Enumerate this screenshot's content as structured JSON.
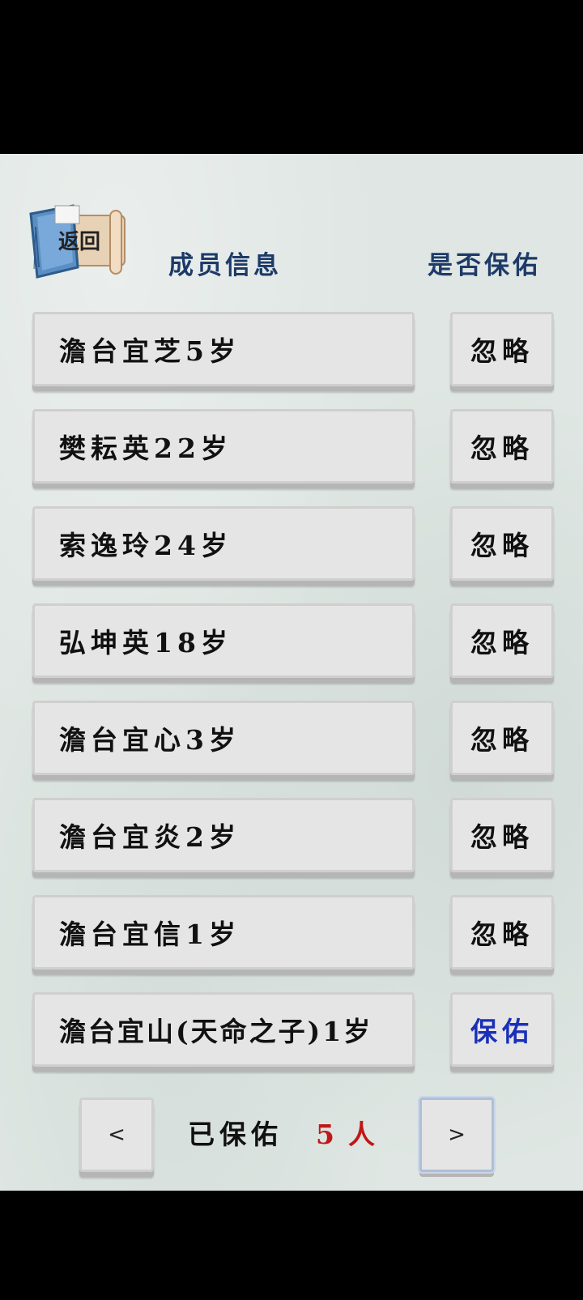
{
  "header": {
    "back_label": "返回",
    "col_member": "成员信息",
    "col_bless": "是否保佑"
  },
  "members": [
    {
      "name": "澹台宜芝5岁",
      "action": "忽略"
    },
    {
      "name": "樊耘英22岁",
      "action": "忽略"
    },
    {
      "name": "索逸玲24岁",
      "action": "忽略"
    },
    {
      "name": "弘坤英18岁",
      "action": "忽略"
    },
    {
      "name": "澹台宜心3岁",
      "action": "忽略"
    },
    {
      "name": "澹台宜炎2岁",
      "action": "忽略"
    },
    {
      "name": "澹台宜信1岁",
      "action": "忽略"
    },
    {
      "name": "澹台宜山(天命之子)1岁",
      "action": "保佑"
    }
  ],
  "footer": {
    "prev_label": "<",
    "next_label": ">",
    "summary_label": "已保佑",
    "summary_count": "5",
    "summary_unit": "人"
  },
  "colors": {
    "header_text": "#1d3a68",
    "bless_text": "#1a2fb8",
    "count_text": "#c01818"
  },
  "icons": {
    "back": "book-scroll-icon"
  }
}
